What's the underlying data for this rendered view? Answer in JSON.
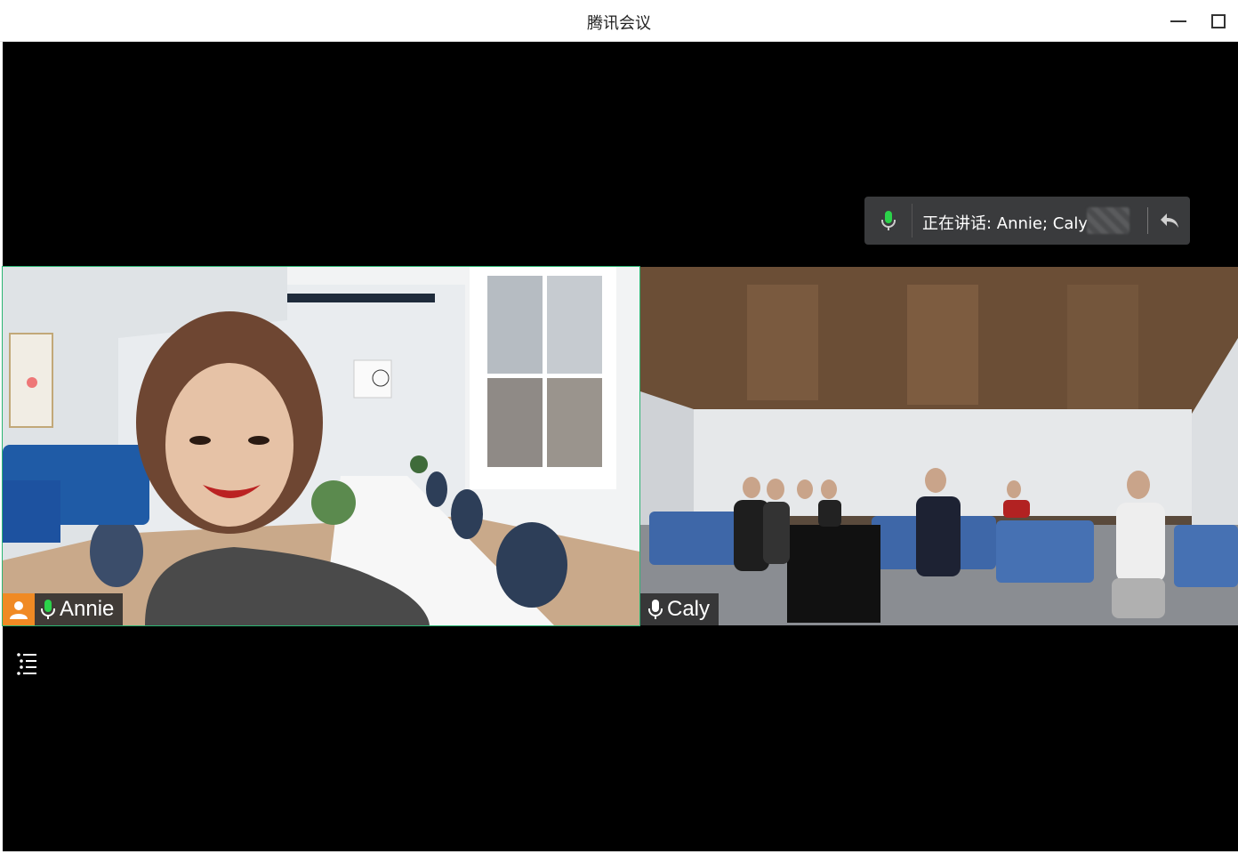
{
  "window": {
    "title": "腾讯会议"
  },
  "speaking_bar": {
    "text": "正在讲话: Annie; Caly;"
  },
  "participants": [
    {
      "name": "Annie",
      "mic": "green",
      "avatar_icon": "user-icon",
      "active_speaker": true
    },
    {
      "name": "Caly",
      "mic": "white"
    }
  ],
  "colors": {
    "active_border": "#2bb673",
    "avatar_badge": "#f08a24",
    "mic_active": "#2bd24a"
  }
}
